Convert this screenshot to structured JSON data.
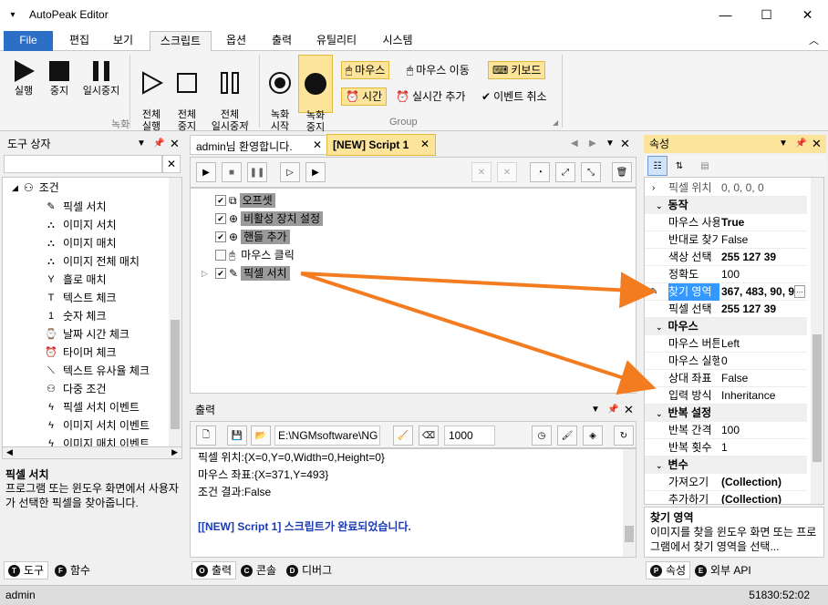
{
  "app": {
    "title": "AutoPeak Editor"
  },
  "window_controls": {
    "minimize": "—",
    "maximize": "☐",
    "close": "✕"
  },
  "menu": {
    "file": "File",
    "tabs": [
      "편집",
      "보기",
      "스크립트",
      "옵션",
      "출력",
      "유틸리티",
      "시스템"
    ],
    "active_tab": "스크립트"
  },
  "ribbon": {
    "record_group_label": "녹화",
    "group_label": "Group",
    "buttons": {
      "run": "실행",
      "stop": "중지",
      "pause": "일시중지",
      "run_all": "전체\n실행",
      "stop_all": "전체\n중지",
      "pause_all": "전체\n일시중지",
      "record_start": "녹화\n시작",
      "record_stop": "녹화\n중지"
    },
    "options": {
      "mouse": "마우스",
      "mouse_move": "마우스 이동",
      "keyboard": "키보드",
      "time": "시간",
      "realtime_add": "실시간 추가",
      "event_cancel": "이벤트 취소"
    }
  },
  "toolbox": {
    "title": "도구 상자",
    "search_value": "",
    "category": "조건",
    "items": [
      "픽셀 서치",
      "이미지 서치",
      "이미지 매치",
      "이미지 전체 매치",
      "흘로 매치",
      "텍스트 체크",
      "숫자 체크",
      "날짜 시간 체크",
      "타이머 체크",
      "텍스트 유사율 체크",
      "다중 조건",
      "픽셀 서치 이벤트",
      "이미지 서치 이벤트",
      "이미지 매치 이벤트"
    ],
    "desc_title": "픽셀 서치",
    "desc_text": "프로그램 또는 윈도우 화면에서 사용자가 선택한 픽셀을 찾아줍니다.",
    "bottom_tabs": [
      "도구",
      "함수"
    ]
  },
  "editor": {
    "tabs": [
      "admin님 환영합니다.",
      "[NEW] Script 1"
    ],
    "active_tab": "[NEW] Script 1",
    "nodes": [
      {
        "label": "오프셋",
        "checked": true,
        "highlight": true
      },
      {
        "label": "비활성 장치 설정",
        "checked": true,
        "highlight": true
      },
      {
        "label": "핸들 추가",
        "checked": true,
        "highlight": true
      },
      {
        "label": "마우스 클릭",
        "checked": false,
        "highlight": false
      },
      {
        "label": "픽셀 서치",
        "checked": true,
        "highlight": true
      }
    ]
  },
  "output": {
    "title": "출력",
    "path_value": "E:\\NGMsoftware\\NG",
    "count_value": "1000",
    "lines": [
      "픽셀 위치:{X=0,Y=0,Width=0,Height=0}",
      "마우스 좌표:{X=371,Y=493}",
      "조건 결과:False",
      "",
      "[[NEW] Script 1] 스크립트가 완료되었습니다."
    ],
    "bottom_tabs": [
      "출력",
      "콘솔",
      "디버그"
    ]
  },
  "properties": {
    "title": "속성",
    "rows": [
      {
        "type": "row",
        "name": "픽셀 위치",
        "value": "0, 0, 0, 0",
        "dim": true
      },
      {
        "type": "cat",
        "name": "동작"
      },
      {
        "type": "row",
        "name": "마우스 사용",
        "value": "True",
        "bold": true
      },
      {
        "type": "row",
        "name": "반대로 찾기",
        "value": "False"
      },
      {
        "type": "row",
        "name": "색상 선택",
        "value": "255 127 39",
        "bold": true
      },
      {
        "type": "row",
        "name": "정확도",
        "value": "100"
      },
      {
        "type": "row",
        "name": "찾기 영역",
        "value": "367, 483, 90, 9",
        "bold": true,
        "selected": true
      },
      {
        "type": "row",
        "name": "픽셀 선택",
        "value": "255 127 39",
        "bold": true
      },
      {
        "type": "cat",
        "name": "마우스"
      },
      {
        "type": "row",
        "name": "마우스 버튼",
        "value": "Left"
      },
      {
        "type": "row",
        "name": "마우스 실행",
        "value": "0"
      },
      {
        "type": "row",
        "name": "상대 좌표",
        "value": "False"
      },
      {
        "type": "row",
        "name": "입력 방식",
        "value": "Inheritance"
      },
      {
        "type": "cat",
        "name": "반복 설정"
      },
      {
        "type": "row",
        "name": "반복 간격",
        "value": "100"
      },
      {
        "type": "row",
        "name": "반복 횟수",
        "value": "1"
      },
      {
        "type": "cat",
        "name": "변수"
      },
      {
        "type": "row",
        "name": "가져오기",
        "value": "(Collection)",
        "bold": true
      },
      {
        "type": "row",
        "name": "추가하기",
        "value": "(Collection)",
        "bold": true
      }
    ],
    "desc_title": "찾기 영역",
    "desc_text": "이미지를 찾을 윈도우 화면 또는 프로그램에서 찾기 영역을 선택...",
    "bottom_tabs": [
      "속성",
      "외부 API"
    ]
  },
  "status": {
    "user": "admin",
    "time": "51830:52:02"
  },
  "colors": {
    "accent": "#2b6fc6",
    "arrow": "#f47c20",
    "highlight": "#fde49b",
    "selected": "#3399ff"
  }
}
